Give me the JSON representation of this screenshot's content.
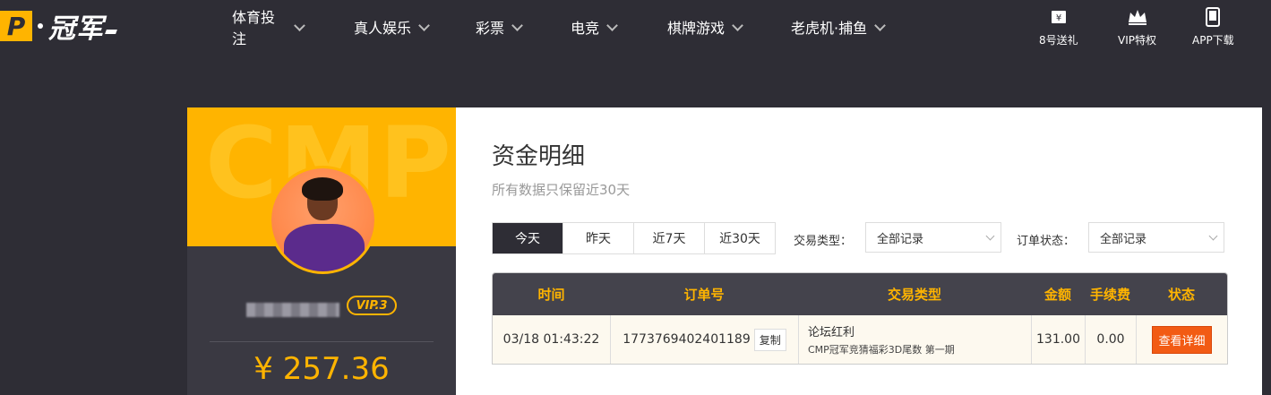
{
  "header": {
    "logo_letter": "P",
    "logo_text": "冠军",
    "nav": [
      {
        "label": "体育投注"
      },
      {
        "label": "真人娱乐"
      },
      {
        "label": "彩票"
      },
      {
        "label": "电竞"
      },
      {
        "label": "棋牌游戏"
      },
      {
        "label": "老虎机·捕鱼"
      }
    ],
    "quick_links": [
      {
        "label": "8号送礼",
        "icon": "ticket-icon"
      },
      {
        "label": "VIP特权",
        "icon": "crown-icon"
      },
      {
        "label": "APP下载",
        "icon": "phone-icon"
      }
    ]
  },
  "profile": {
    "bg_text": "CMP",
    "vip_level": "VIP.3",
    "balance": "¥ 257.36"
  },
  "main": {
    "title": "资金明细",
    "subtitle": "所有数据只保留近30天",
    "date_tabs": [
      {
        "label": "今天",
        "active": true
      },
      {
        "label": "昨天",
        "active": false
      },
      {
        "label": "近7天",
        "active": false
      },
      {
        "label": "近30天",
        "active": false
      }
    ],
    "filters": {
      "type_label": "交易类型：",
      "type_value": "全部记录",
      "status_label": "订单状态：",
      "status_value": "全部记录"
    },
    "table": {
      "headers": [
        "时间",
        "订单号",
        "交易类型",
        "金额",
        "手续费",
        "状态"
      ],
      "rows": [
        {
          "time": "03/18 01:43:22",
          "order_no": "1773769402401189",
          "copy_label": "复制",
          "type_main": "论坛红利",
          "type_sub": "CMP冠军竞猜福彩3D尾数 第一期",
          "amount": "131.00",
          "fee": "0.00",
          "action_label": "查看详细"
        }
      ]
    }
  },
  "colors": {
    "accent": "#ffb400",
    "dark_bg": "#2e2d35",
    "action": "#f25b14"
  }
}
